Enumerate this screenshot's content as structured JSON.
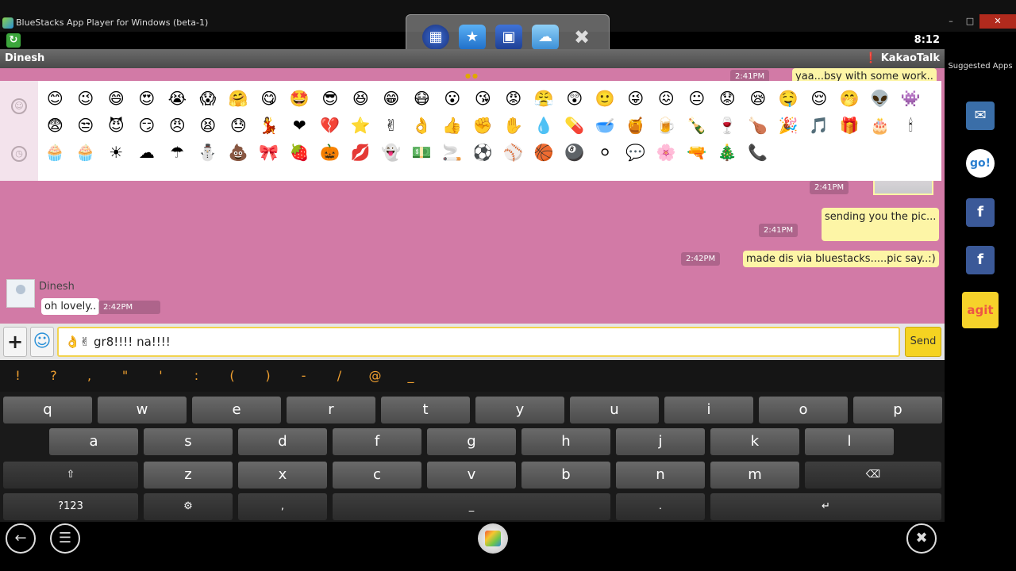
{
  "window": {
    "title": "BlueStacks App Player for Windows (beta-1)",
    "minimize_icon": "minimize-icon",
    "restore_icon": "restore-icon",
    "close_icon": "close-icon"
  },
  "statusbar": {
    "clock": "8:12"
  },
  "dock": {
    "items": [
      "app-grid-icon",
      "favorites-icon",
      "store-icon",
      "cloud-icon",
      "close-icon"
    ]
  },
  "header": {
    "contact": "Dinesh",
    "app_name": "KakaoTalk"
  },
  "chat": {
    "messages": [
      {
        "side": "me",
        "text": "yaa...bsy with some work..",
        "time": "2:41PM"
      },
      {
        "side": "me",
        "text": "",
        "time": "2:41PM",
        "kind": "photo"
      },
      {
        "side": "me",
        "text": "sending you the pic...",
        "time": "2:41PM"
      },
      {
        "side": "me",
        "text": "made dis via bluestacks.....pic say..:)",
        "time": "2:42PM"
      },
      {
        "side": "them",
        "sender": "Dinesh",
        "text": "oh lovely..",
        "time": "2:42PM"
      }
    ]
  },
  "emoticons": {
    "rows": [
      [
        "😊",
        "😉",
        "😄",
        "😍",
        "😭",
        "😱",
        "🤗",
        "😋",
        "🤩",
        "😎",
        "😆",
        "😁",
        "😷",
        "😮",
        "😘",
        "😡",
        "😤",
        "😲",
        "🙂",
        "😜",
        "😖",
        "😐",
        "😟",
        "😪",
        "🤤",
        "😌",
        "🤭",
        "👽",
        "👾"
      ],
      [
        "😨",
        "😒",
        "😈",
        "😏",
        "😠",
        "😫",
        "😓",
        "💃",
        "❤",
        "💔",
        "⭐",
        "✌",
        "👌",
        "👍",
        "✊",
        "✋",
        "💧",
        "💊",
        "🥣",
        "🍯",
        "🍺",
        "🍾",
        "🍷",
        "🍗",
        "🎉",
        "🎵",
        "🎁",
        "🎂",
        "🕯"
      ],
      [
        "🧁",
        "🧁",
        "☀",
        "☁",
        "☂",
        "⛄",
        "💩",
        "🎀",
        "🍓",
        "🎃",
        "💋",
        "👻",
        "💵",
        "🚬",
        "⚽",
        "⚾",
        "🏀",
        "🎱",
        "⚪",
        "💬",
        "🌸",
        "🔫",
        "🎄",
        "📞"
      ]
    ]
  },
  "input": {
    "value": "👌✌ gr8!!!! na!!!!",
    "send_label": "Send"
  },
  "symbols": [
    "!",
    "?",
    ",",
    "\"",
    "'",
    ":",
    "(",
    ")",
    "-",
    "/",
    "@",
    "_"
  ],
  "keyboard": {
    "row1": [
      "q",
      "w",
      "e",
      "r",
      "t",
      "y",
      "u",
      "i",
      "o",
      "p"
    ],
    "row2": [
      "a",
      "s",
      "d",
      "f",
      "g",
      "h",
      "j",
      "k",
      "l"
    ],
    "row3": [
      "z",
      "x",
      "c",
      "v",
      "b",
      "n",
      "m"
    ],
    "numbers_label": "?123",
    "comma": ",",
    "space": "_",
    "period": "."
  },
  "sidebar": {
    "title": "Suggested Apps",
    "apps": [
      "messenger-icon",
      "gochat-icon",
      "facebook-icon",
      "facebook-icon",
      "agit-icon"
    ]
  }
}
